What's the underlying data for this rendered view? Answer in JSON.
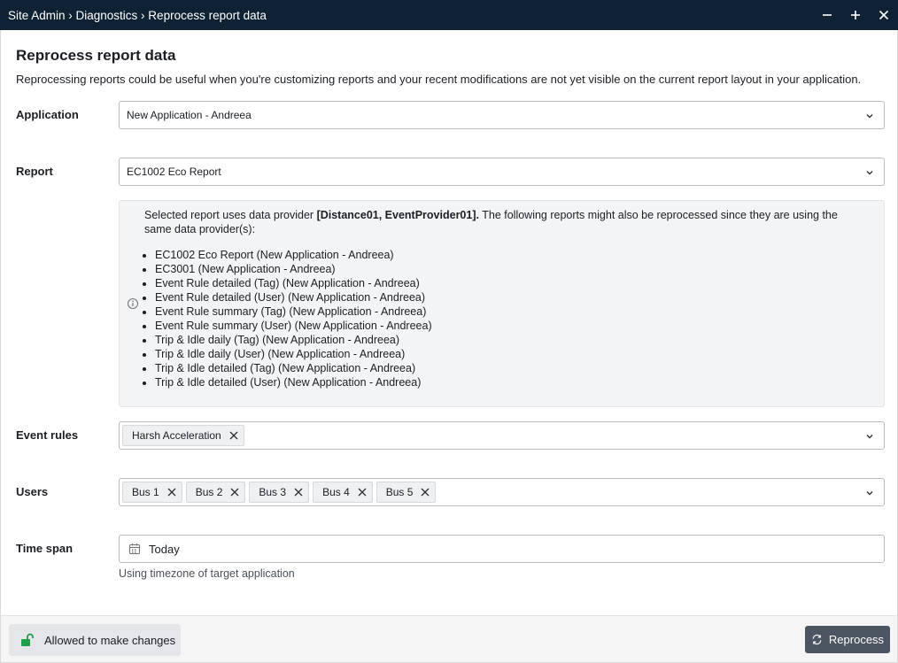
{
  "titlebar": {
    "breadcrumb": "Site Admin › Diagnostics › Reprocess report data",
    "icons": [
      "minimize-icon",
      "maximize-icon",
      "close-icon"
    ]
  },
  "page": {
    "title": "Reprocess report data",
    "description": "Reprocessing reports could be useful when you're customizing reports and your recent modifications are not yet visible on the current report layout in your application."
  },
  "form": {
    "application": {
      "label": "Application",
      "value": "New Application - Andreea"
    },
    "report": {
      "label": "Report",
      "value": "EC1002 Eco Report"
    },
    "info": {
      "prefix": "Selected report uses data provider ",
      "providers": "[Distance01, EventProvider01].",
      "suffix": " The following reports might also be reprocessed since they are using the same data provider(s):",
      "reports": [
        "EC1002 Eco Report (New Application - Andreea)",
        "EC3001 (New Application - Andreea)",
        "Event Rule detailed (Tag) (New Application - Andreea)",
        "Event Rule detailed (User) (New Application - Andreea)",
        "Event Rule summary (Tag) (New Application - Andreea)",
        "Event Rule summary (User) (New Application - Andreea)",
        "Trip & Idle daily (Tag) (New Application - Andreea)",
        "Trip & Idle daily (User) (New Application - Andreea)",
        "Trip & Idle detailed (Tag) (New Application - Andreea)",
        "Trip & Idle detailed (User) (New Application - Andreea)"
      ]
    },
    "event_rules": {
      "label": "Event rules",
      "tags": [
        "Harsh Acceleration"
      ]
    },
    "users": {
      "label": "Users",
      "tags": [
        "Bus 1",
        "Bus 2",
        "Bus 3",
        "Bus 4",
        "Bus 5"
      ]
    },
    "time_span": {
      "label": "Time span",
      "value": "Today",
      "hint": "Using timezone of target application"
    }
  },
  "footer": {
    "allowed_label": "Allowed to make changes",
    "reprocess_label": "Reprocess",
    "allowed_icon_color": "#1e9e4a"
  }
}
